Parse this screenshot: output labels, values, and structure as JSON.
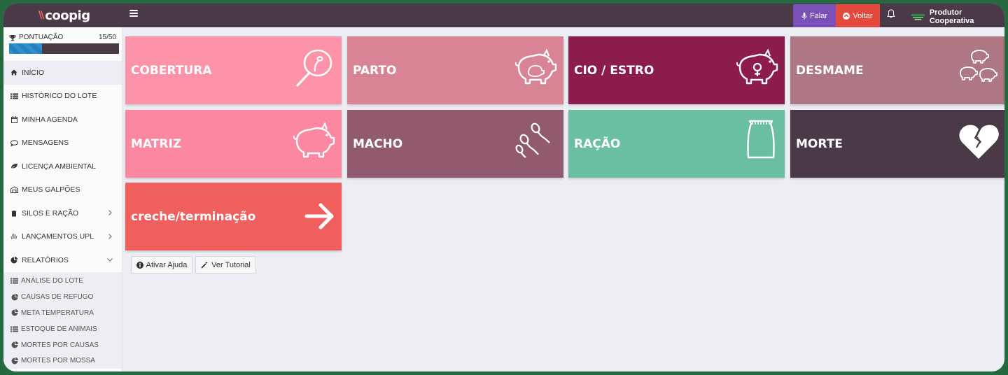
{
  "app": {
    "logo_mark": "\\\\",
    "logo_text": "coopig"
  },
  "topbar": {
    "falar_label": "Falar",
    "voltar_label": "Voltar",
    "user_name": "Produtor Cooperativa"
  },
  "colors": {
    "topbar": "#4a3a48",
    "falar": "#7a4fb8",
    "voltar": "#e3493c",
    "frame_border": "#24693f"
  },
  "sidebar": {
    "score": {
      "label": "PONTUAÇÃO",
      "value_text": "15/50",
      "progress": 0.3
    },
    "items": [
      {
        "label": "INÍCIO",
        "icon": "home-icon"
      },
      {
        "label": "HISTÓRICO DO LOTE",
        "icon": "list-icon"
      },
      {
        "label": "MINHA AGENDA",
        "icon": "calendar-icon"
      },
      {
        "label": "MENSAGENS",
        "icon": "chat-icon"
      },
      {
        "label": "LICENÇA AMBIENTAL",
        "icon": "leaf-icon"
      },
      {
        "label": "MEUS GALPÕES",
        "icon": "barn-icon"
      },
      {
        "label": "SILOS E RAÇÃO",
        "icon": "silo-icon"
      },
      {
        "label": "LANÇAMENTOS UPL",
        "icon": "hand-icon"
      },
      {
        "label": "RELATÓRIOS",
        "icon": "pie-chart-icon"
      }
    ],
    "sub_items": [
      {
        "label": "ANÁLISE DO LOTE",
        "icon": "list-icon"
      },
      {
        "label": "CAUSAS DE REFUGO",
        "icon": "pie-chart-icon"
      },
      {
        "label": "META TEMPERATURA",
        "icon": "pie-chart-icon"
      },
      {
        "label": "ESTOQUE DE ANIMAIS",
        "icon": "list-icon"
      },
      {
        "label": "MORTES POR CAUSAS",
        "icon": "pie-chart-icon"
      },
      {
        "label": "MORTES POR MOSSA",
        "icon": "pie-chart-icon"
      }
    ]
  },
  "tiles": [
    {
      "label": "COBERTURA",
      "color": "#fd93a9",
      "icon": "magnifier-icon"
    },
    {
      "label": "PARTO",
      "color": "#d98495",
      "icon": "pregnant-pig-icon"
    },
    {
      "label": "CIO / ESTRO",
      "color": "#8c1c4c",
      "icon": "female-pig-icon"
    },
    {
      "label": "DESMAME",
      "color": "#ad7784",
      "icon": "piglets-icon"
    },
    {
      "label": "MATRIZ",
      "color": "#fc87a0",
      "icon": "pig-icon"
    },
    {
      "label": "MACHO",
      "color": "#915a6f",
      "icon": "sperm-icon"
    },
    {
      "label": "RAÇÃO",
      "color": "#6abfa3",
      "icon": "feed-bag-icon"
    },
    {
      "label": "MORTE",
      "color": "#4a3a48",
      "icon": "broken-heart-icon"
    },
    {
      "label": "creche/terminação",
      "color": "#ef5f5e",
      "icon": "arrow-right-icon"
    }
  ],
  "help": {
    "ativar_label": "Ativar Ajuda",
    "tutorial_label": "Ver Tutorial"
  }
}
